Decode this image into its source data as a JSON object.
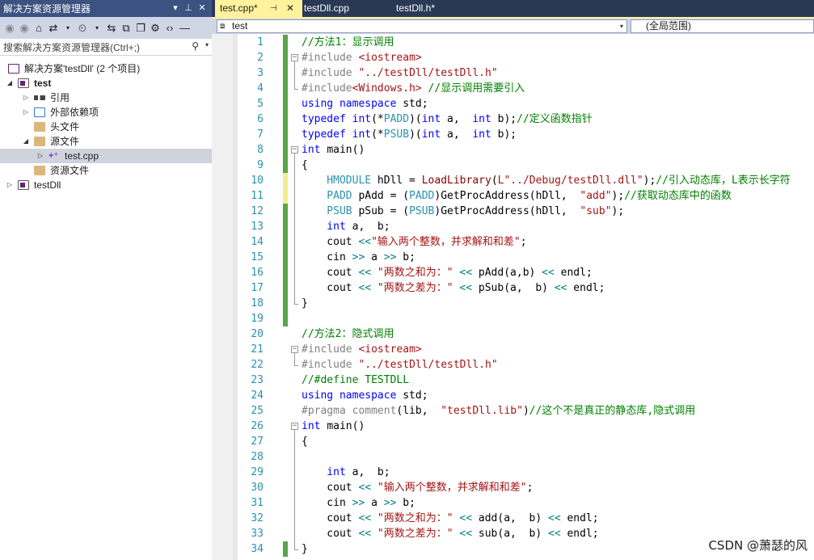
{
  "solution_explorer": {
    "title": "解决方案资源管理器",
    "search_placeholder": "搜索解决方案资源管理器(Ctrl+;)",
    "solution_label": "解决方案'testDll' (2 个项目)",
    "project_test": "test",
    "ref": "引用",
    "external_deps": "外部依赖项",
    "headers": "头文件",
    "sources": "源文件",
    "test_cpp": "test.cpp",
    "resources": "资源文件",
    "project_testdll": "testDll"
  },
  "tabs": [
    {
      "label": "test.cpp*",
      "active": true
    },
    {
      "label": "testDll.cpp",
      "active": false
    },
    {
      "label": "testDll.h*",
      "active": false
    }
  ],
  "navbar": {
    "scope_left": "test",
    "scope_right": "(全局范围)"
  },
  "colors": {
    "accent_title": "#3c5280",
    "active_tab": "#fff29d",
    "change_saved": "#57a64a",
    "change_unsaved": "#efef8e"
  },
  "code_lines": [
    {
      "n": "1",
      "tokens": [
        [
          "c-com",
          "//方法1：显示调用"
        ]
      ]
    },
    {
      "n": "2",
      "tokens": [
        [
          "c-pp",
          "#include "
        ],
        [
          "c-str",
          "<iostream>"
        ]
      ]
    },
    {
      "n": "3",
      "tokens": [
        [
          "c-pp",
          "#include "
        ],
        [
          "c-str",
          "\"../testDll/testDll.h\""
        ]
      ]
    },
    {
      "n": "4",
      "tokens": [
        [
          "c-pp",
          "#include"
        ],
        [
          "c-str",
          "<Windows.h>"
        ],
        [
          "c-com",
          " //显示调用需要引入"
        ]
      ]
    },
    {
      "n": "5",
      "tokens": [
        [
          "c-kw",
          "using namespace "
        ],
        [
          "c-var",
          "std;"
        ]
      ]
    },
    {
      "n": "6",
      "tokens": [
        [
          "c-kw",
          "typedef int"
        ],
        [
          "c-var",
          "(*"
        ],
        [
          "c-typ",
          "PADD"
        ],
        [
          "c-var",
          ")("
        ],
        [
          "c-kw",
          "int"
        ],
        [
          "c-var",
          " a,  "
        ],
        [
          "c-kw",
          "int"
        ],
        [
          "c-var",
          " b);"
        ],
        [
          "c-com",
          "//定义函数指针"
        ]
      ]
    },
    {
      "n": "7",
      "tokens": [
        [
          "c-kw",
          "typedef int"
        ],
        [
          "c-var",
          "(*"
        ],
        [
          "c-typ",
          "PSUB"
        ],
        [
          "c-var",
          ")("
        ],
        [
          "c-kw",
          "int"
        ],
        [
          "c-var",
          " a,  "
        ],
        [
          "c-kw",
          "int"
        ],
        [
          "c-var",
          " b);"
        ]
      ]
    },
    {
      "n": "8",
      "tokens": [
        [
          "c-kw",
          "int "
        ],
        [
          "c-var",
          "main()"
        ]
      ]
    },
    {
      "n": "9",
      "tokens": [
        [
          "c-var",
          "{"
        ]
      ]
    },
    {
      "n": "10",
      "tokens": [
        [
          "c-typ",
          "    HMODULE "
        ],
        [
          "c-var",
          "hDll = "
        ],
        [
          "c-fn",
          "LoadLibrary"
        ],
        [
          "c-var",
          "("
        ],
        [
          "c-str",
          "L\"../Debug/testDll.dll\""
        ],
        [
          "c-var",
          ");"
        ],
        [
          "c-com",
          "//引入动态库，L表示长字符"
        ]
      ]
    },
    {
      "n": "11",
      "tokens": [
        [
          "c-typ",
          "    PADD "
        ],
        [
          "c-var",
          "pAdd = ("
        ],
        [
          "c-typ",
          "PADD"
        ],
        [
          "c-var",
          ")GetProcAddress(hDll,  "
        ],
        [
          "c-str",
          "\"add\""
        ],
        [
          "c-var",
          ");"
        ],
        [
          "c-com",
          "//获取动态库中的函数"
        ]
      ]
    },
    {
      "n": "12",
      "tokens": [
        [
          "c-typ",
          "    PSUB "
        ],
        [
          "c-var",
          "pSub = ("
        ],
        [
          "c-typ",
          "PSUB"
        ],
        [
          "c-var",
          ")GetProcAddress(hDll,  "
        ],
        [
          "c-str",
          "\"sub\""
        ],
        [
          "c-var",
          ");"
        ]
      ]
    },
    {
      "n": "13",
      "tokens": [
        [
          "c-kw",
          "    int "
        ],
        [
          "c-var",
          "a,  b;"
        ]
      ]
    },
    {
      "n": "14",
      "tokens": [
        [
          "c-var",
          "    cout "
        ],
        [
          "c-op",
          "<<"
        ],
        [
          "c-str",
          "\"输入两个整数，并求解和和差\""
        ],
        [
          "c-var",
          ";"
        ]
      ]
    },
    {
      "n": "15",
      "tokens": [
        [
          "c-var",
          "    cin "
        ],
        [
          "c-op",
          ">>"
        ],
        [
          "c-var",
          " a "
        ],
        [
          "c-op",
          ">>"
        ],
        [
          "c-var",
          " b;"
        ]
      ]
    },
    {
      "n": "16",
      "tokens": [
        [
          "c-var",
          "    cout "
        ],
        [
          "c-op",
          "<<"
        ],
        [
          "c-str",
          " \"两数之和为：\" "
        ],
        [
          "c-op",
          "<<"
        ],
        [
          "c-var",
          " pAdd(a,b) "
        ],
        [
          "c-op",
          "<<"
        ],
        [
          "c-var",
          " endl;"
        ]
      ]
    },
    {
      "n": "17",
      "tokens": [
        [
          "c-var",
          "    cout "
        ],
        [
          "c-op",
          "<<"
        ],
        [
          "c-str",
          " \"两数之差为：\" "
        ],
        [
          "c-op",
          "<<"
        ],
        [
          "c-var",
          " pSub(a,  b) "
        ],
        [
          "c-op",
          "<<"
        ],
        [
          "c-var",
          " endl;"
        ]
      ]
    },
    {
      "n": "18",
      "tokens": [
        [
          "c-var",
          "}"
        ]
      ]
    },
    {
      "n": "19",
      "tokens": []
    },
    {
      "n": "20",
      "tokens": [
        [
          "c-com",
          "//方法2：隐式调用"
        ]
      ]
    },
    {
      "n": "21",
      "tokens": [
        [
          "c-pp",
          "#include "
        ],
        [
          "c-str",
          "<iostream>"
        ]
      ]
    },
    {
      "n": "22",
      "tokens": [
        [
          "c-pp",
          "#include "
        ],
        [
          "c-str",
          "\"../testDll/testDll.h\""
        ]
      ]
    },
    {
      "n": "23",
      "tokens": [
        [
          "c-com",
          "//#define TESTDLL"
        ]
      ]
    },
    {
      "n": "24",
      "tokens": [
        [
          "c-kw",
          "using namespace "
        ],
        [
          "c-var",
          "std;"
        ]
      ]
    },
    {
      "n": "25",
      "tokens": [
        [
          "c-pp",
          "#pragma comment"
        ],
        [
          "c-var",
          "(lib,  "
        ],
        [
          "c-str",
          "\"testDll.lib\""
        ],
        [
          "c-var",
          ")"
        ],
        [
          "c-com",
          "//这个不是真正的静态库,隐式调用"
        ]
      ]
    },
    {
      "n": "26",
      "tokens": [
        [
          "c-kw",
          "int "
        ],
        [
          "c-var",
          "main()"
        ]
      ]
    },
    {
      "n": "27",
      "tokens": [
        [
          "c-var",
          "{"
        ]
      ]
    },
    {
      "n": "28",
      "tokens": []
    },
    {
      "n": "29",
      "tokens": [
        [
          "c-kw",
          "    int "
        ],
        [
          "c-var",
          "a,  b;"
        ]
      ]
    },
    {
      "n": "30",
      "tokens": [
        [
          "c-var",
          "    cout "
        ],
        [
          "c-op",
          "<<"
        ],
        [
          "c-str",
          " \"输入两个整数，并求解和和差\""
        ],
        [
          "c-var",
          ";"
        ]
      ]
    },
    {
      "n": "31",
      "tokens": [
        [
          "c-var",
          "    cin "
        ],
        [
          "c-op",
          ">>"
        ],
        [
          "c-var",
          " a "
        ],
        [
          "c-op",
          ">>"
        ],
        [
          "c-var",
          " b;"
        ]
      ]
    },
    {
      "n": "32",
      "tokens": [
        [
          "c-var",
          "    cout "
        ],
        [
          "c-op",
          "<<"
        ],
        [
          "c-str",
          " \"两数之和为：\" "
        ],
        [
          "c-op",
          "<<"
        ],
        [
          "c-var",
          " add(a,  b) "
        ],
        [
          "c-op",
          "<<"
        ],
        [
          "c-var",
          " endl;"
        ]
      ]
    },
    {
      "n": "33",
      "tokens": [
        [
          "c-var",
          "    cout "
        ],
        [
          "c-op",
          "<<"
        ],
        [
          "c-str",
          " \"两数之差为：\" "
        ],
        [
          "c-op",
          "<<"
        ],
        [
          "c-var",
          " sub(a,  b) "
        ],
        [
          "c-op",
          "<<"
        ],
        [
          "c-var",
          " endl;"
        ]
      ]
    },
    {
      "n": "34",
      "tokens": [
        [
          "c-var",
          "}"
        ]
      ]
    }
  ],
  "watermark": "CSDN @萧瑟的风"
}
